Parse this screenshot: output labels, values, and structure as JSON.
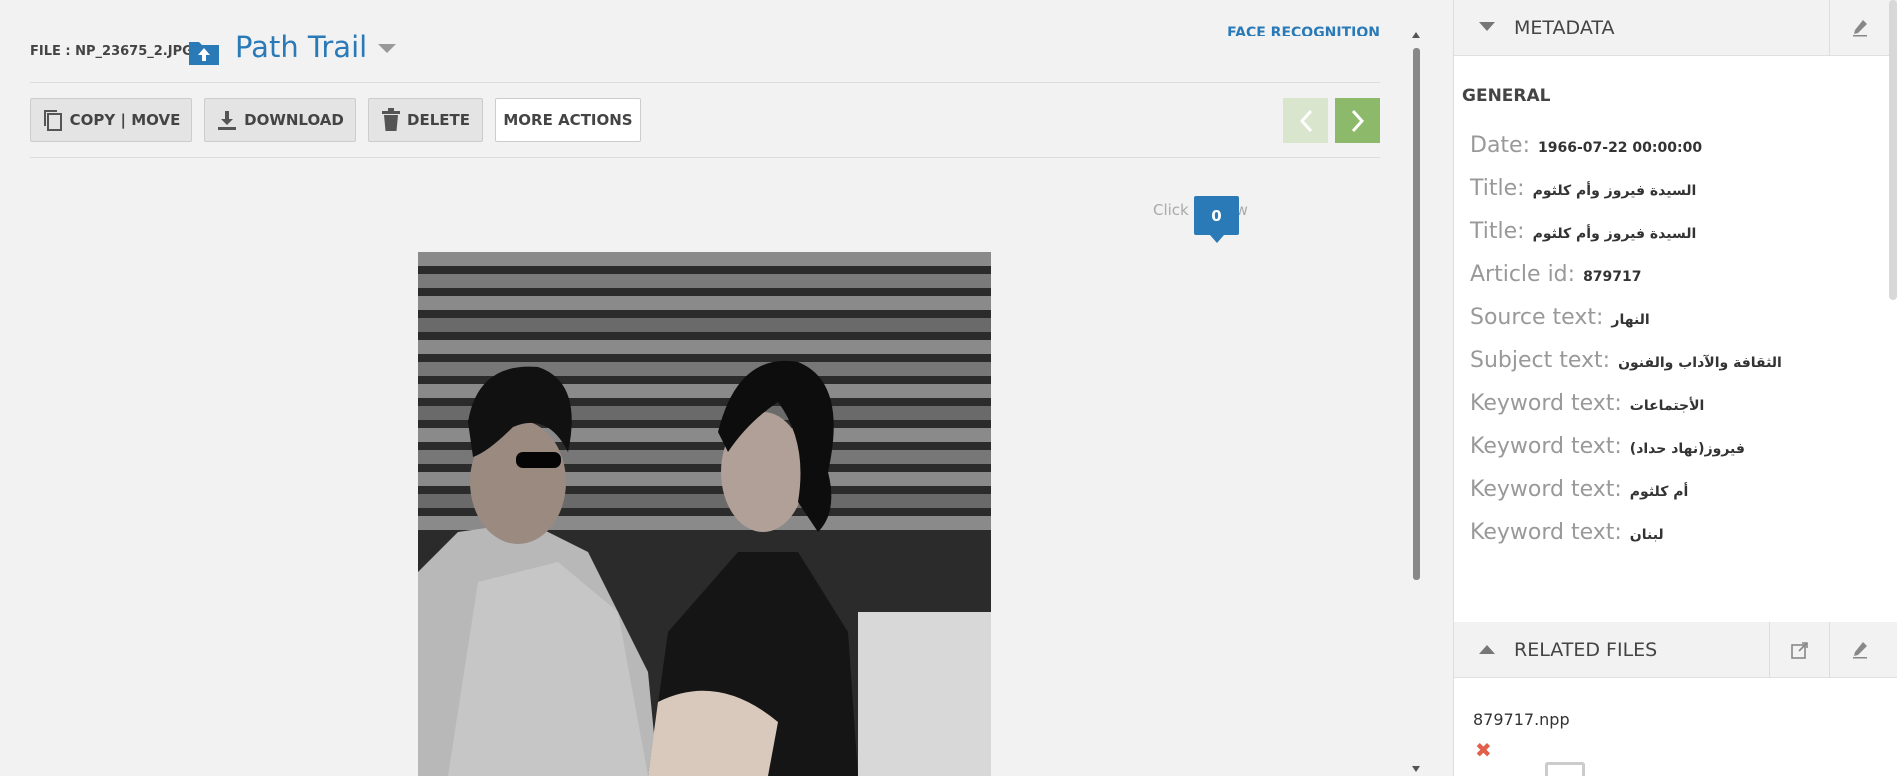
{
  "header": {
    "file_label": "FILE : NP_23675_2.JPG",
    "path_title": "Path Trail",
    "face_recognition": "FACE RECOGNITION"
  },
  "toolbar": {
    "copy_move": "COPY | MOVE",
    "download": "DOWNLOAD",
    "delete": "DELETE",
    "more_actions": "MORE ACTIONS"
  },
  "viewer": {
    "click_to_view": "Click to view",
    "face_count": "0"
  },
  "metadata": {
    "header": "METADATA",
    "section": "GENERAL",
    "fields": [
      {
        "key": "Date:",
        "value": "1966-07-22 00:00:00"
      },
      {
        "key": "Title:",
        "value": "السيدة فيروز وأم كلثوم"
      },
      {
        "key": "Title:",
        "value": "السيدة فيروز وأم كلثوم"
      },
      {
        "key": "Article id:",
        "value": "879717"
      },
      {
        "key": "Source text:",
        "value": "النهار"
      },
      {
        "key": "Subject text:",
        "value": "الثقافة والآداب والفنون"
      },
      {
        "key": "Keyword text:",
        "value": "الأجتماعات"
      },
      {
        "key": "Keyword text:",
        "value": "فيروز(نهاد حداد)"
      },
      {
        "key": "Keyword text:",
        "value": "أم كلثوم"
      },
      {
        "key": "Keyword text:",
        "value": "لبنان"
      }
    ]
  },
  "related": {
    "header": "RELATED FILES",
    "file": "879717.npp"
  },
  "colors": {
    "accent": "#2a7ab8",
    "next": "#8cb96a",
    "prev_disabled": "#d9e6cd",
    "remove": "#e0604a"
  },
  "icons": [
    "folder-up-icon",
    "copy-icon",
    "download-icon",
    "trash-icon",
    "chevron-left-icon",
    "chevron-right-icon",
    "pencil-icon",
    "external-link-icon",
    "remove-icon",
    "document-icon"
  ]
}
